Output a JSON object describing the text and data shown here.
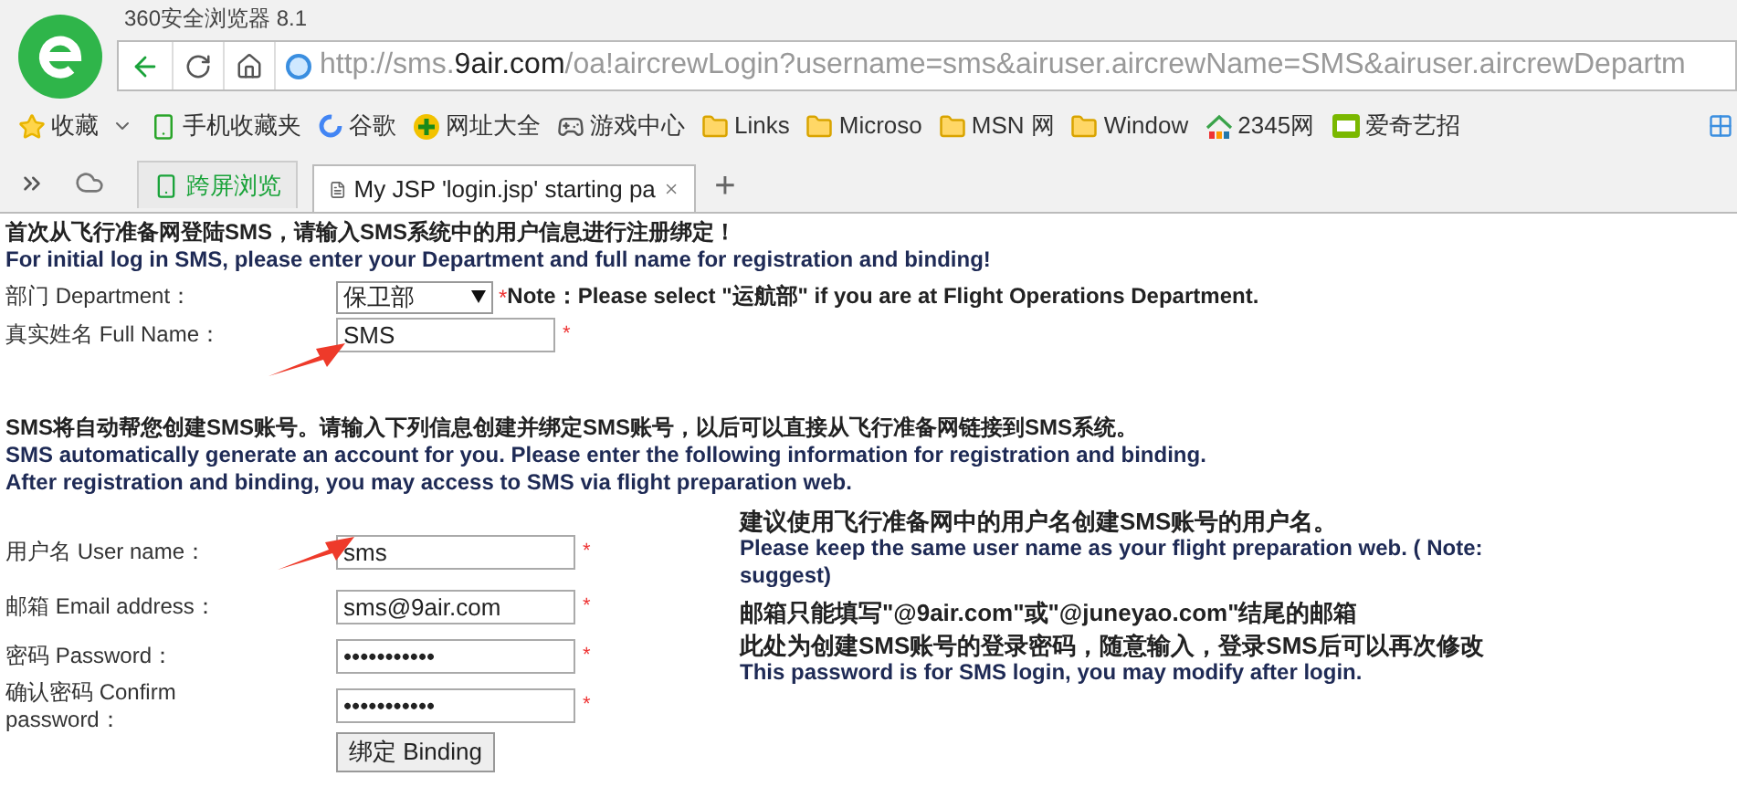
{
  "browser": {
    "app_title": "360安全浏览器 8.1",
    "url": {
      "prefix": "http://sms.",
      "domain": "9air.com",
      "path": "/oa!aircrewLogin?username=sms&airuser.aircrewName=SMS&airuser.aircrewDepartm"
    },
    "bookmarks": [
      {
        "label": "收藏",
        "kind": "favorites"
      },
      {
        "label": "手机收藏夹",
        "kind": "phone"
      },
      {
        "label": "谷歌",
        "kind": "google"
      },
      {
        "label": "网址大全",
        "kind": "plus"
      },
      {
        "label": "游戏中心",
        "kind": "game"
      },
      {
        "label": "Links",
        "kind": "folder"
      },
      {
        "label": "Microso",
        "kind": "folder"
      },
      {
        "label": "MSN 网",
        "kind": "folder"
      },
      {
        "label": "Window",
        "kind": "folder"
      },
      {
        "label": "2345网",
        "kind": "house"
      },
      {
        "label": "爱奇艺招",
        "kind": "video"
      }
    ],
    "tabs": [
      {
        "label": "跨屏浏览",
        "kind": "sync",
        "selected": false
      },
      {
        "label": "My JSP 'login.jsp' starting pa",
        "kind": "page",
        "selected": true
      }
    ],
    "new_tab": "+"
  },
  "page": {
    "heading_zh": "首次从飞行准备网登陆SMS，请输入SMS系统中的用户信息进行注册绑定！",
    "heading_en": "For initial log in SMS, please enter your Department and full name for registration and binding!",
    "department": {
      "label": "部门 Department：",
      "value": "保卫部",
      "required": "*",
      "note": "Note：Please select \"运航部\" if you are at Flight Operations Department."
    },
    "full_name": {
      "label": "真实姓名 Full Name：",
      "value": "SMS",
      "required": "*"
    },
    "intro": [
      "SMS将自动帮您创建SMS账号。请输入下列信息创建并绑定SMS账号，以后可以直接从飞行准备网链接到SMS系统。",
      "SMS automatically generate an account for you. Please enter the following information for registration and binding.",
      "After registration and binding, you may access to SMS via flight preparation web."
    ],
    "fields": [
      {
        "label": "用户名 User name：",
        "value": "sms",
        "required": "*"
      },
      {
        "label": "邮箱 Email address：",
        "value": "sms@9air.com",
        "required": "*"
      },
      {
        "label": "密码 Password：",
        "value": "•••••••••••",
        "required": "*"
      },
      {
        "label": "确认密码 Confirm password：",
        "value": "•••••••••••",
        "required": "*"
      }
    ],
    "hints": [
      {
        "kind": "bold",
        "text": "建议使用飞行准备网中的用户名创建SMS账号的用户名。"
      },
      {
        "kind": "plain",
        "text": "Please keep the same user name as your flight preparation web. ( Note: suggest)"
      },
      {
        "kind": "bold",
        "text": "邮箱只能填写\"@9air.com\"或\"@juneyao.com\"结尾的邮箱"
      },
      {
        "kind": "bold",
        "text": "此处为创建SMS账号的登录密码，随意输入，登录SMS后可以再次修改"
      },
      {
        "kind": "plain",
        "text": "This password is for SMS login, you may modify after login."
      }
    ],
    "submit": "绑定 Binding"
  }
}
